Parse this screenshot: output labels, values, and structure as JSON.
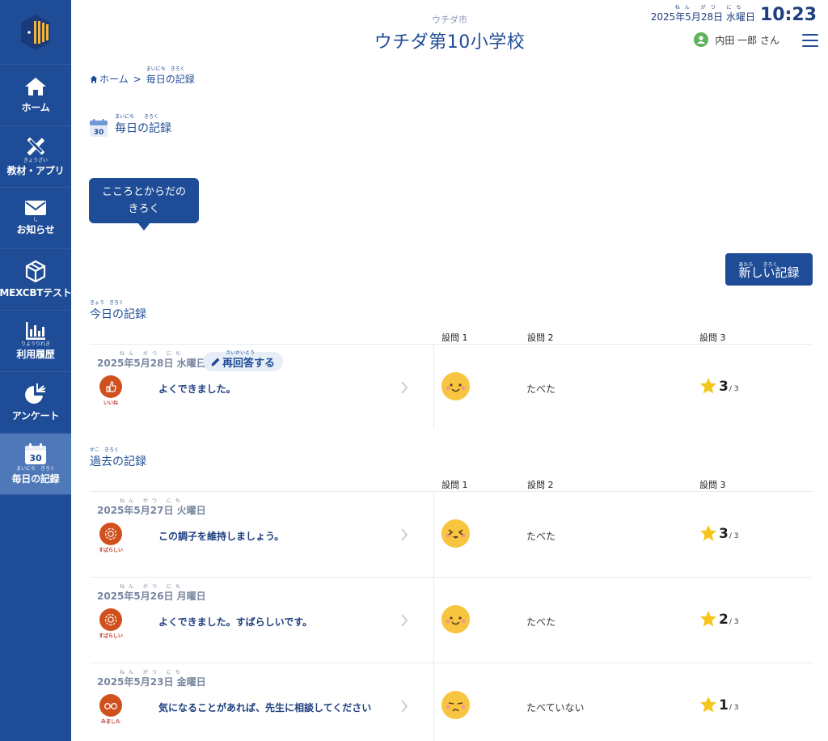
{
  "sidebar": {
    "items": [
      {
        "label": "ホーム",
        "ruby": "",
        "icon": "home-icon"
      },
      {
        "label": "教材・アプリ",
        "ruby": "きょうざい",
        "icon": "pencil-ruler-icon"
      },
      {
        "label": "お知らせ",
        "ruby": "し",
        "icon": "mail-icon"
      },
      {
        "label": "MEXCBTテスト",
        "ruby": "",
        "icon": "cube-icon"
      },
      {
        "label": "利用履歴",
        "ruby": "りようりれき",
        "icon": "bar-chart-icon"
      },
      {
        "label": "アンケート",
        "ruby": "",
        "icon": "pie-chart-icon"
      },
      {
        "label": "毎日の記録",
        "ruby": "まいにち　きろく",
        "icon": "calendar-icon",
        "calendar_day": "30"
      }
    ]
  },
  "header": {
    "city": "ウチダ市",
    "school": "ウチダ第10小学校",
    "date": "2025年5月28日 水曜日",
    "date_ruby": "ねん がつ にち",
    "time": "10:23",
    "user": "内田 一郎 さん"
  },
  "breadcrumb": {
    "home": "ホーム",
    "separator": ">",
    "current": "毎日の記録",
    "current_ruby": "まいにち　きろく"
  },
  "page": {
    "title": "毎日の記録",
    "title_ruby": "まいにち　　きろく",
    "calendar_day": "30",
    "tab_label_line1": "こころとからだの",
    "tab_label_line2": "きろく",
    "new_button": "新しい記録",
    "new_button_ruby": "あたら　　きろく"
  },
  "today": {
    "title": "今日の記録",
    "title_ruby": "きょう　きろく",
    "headers": [
      "設問 1",
      "設問 2",
      "設問 3"
    ],
    "rows": [
      {
        "date": "2025年5月28日 水曜日",
        "date_ruby": "ねん がつ にち",
        "reanswer": "再回答する",
        "reanswer_ruby": "さいかいとう",
        "stamp_text": "いいね",
        "comment": "よくできました。",
        "q2": "たべた",
        "q3_score": "3",
        "q3_max": "/ 3"
      }
    ]
  },
  "past": {
    "title": "過去の記録",
    "title_ruby": "かこ　きろく",
    "headers": [
      "設問 1",
      "設問 2",
      "設問 3"
    ],
    "rows": [
      {
        "date": "2025年5月27日 火曜日",
        "date_ruby": "ねん がつ にち",
        "stamp_text": "すばらしい",
        "comment": "この調子を維持しましょう。",
        "q2": "たべた",
        "q3_score": "3",
        "q3_max": "/ 3"
      },
      {
        "date": "2025年5月26日 月曜日",
        "date_ruby": "ねん がつ にち",
        "stamp_text": "すばらしい",
        "comment": "よくできました。すばらしいです。",
        "q2": "たべた",
        "q3_score": "2",
        "q3_max": "/ 3"
      },
      {
        "date": "2025年5月23日 金曜日",
        "date_ruby": "ねん がつ にち",
        "stamp_text": "みました",
        "comment": "気になることがあれば、先生に相談してください",
        "q2": "たべていない",
        "q3_score": "1",
        "q3_max": "/ 3"
      }
    ]
  },
  "colors": {
    "primary": "#1f4c97",
    "sidebar_active": "#4f78b8",
    "stamp": "#d0501e",
    "face": "#f7c53f",
    "star": "#f5c518"
  }
}
